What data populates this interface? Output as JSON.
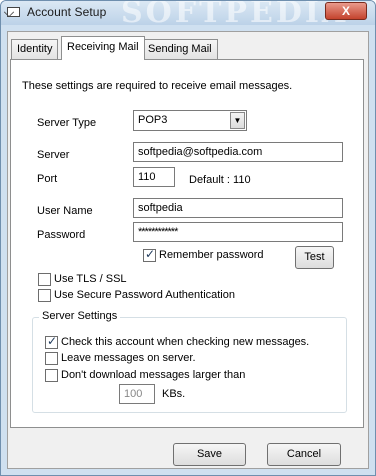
{
  "window": {
    "title": "Account Setup",
    "close_label": "X",
    "watermark": "SOFTPEDIA"
  },
  "tabs": [
    {
      "label": "Identity",
      "active": false
    },
    {
      "label": "Receiving Mail",
      "active": true
    },
    {
      "label": "Sending Mail",
      "active": false
    }
  ],
  "intro": "These settings are required to receive email messages.",
  "fields": {
    "server_type": {
      "label": "Server Type",
      "value": "POP3"
    },
    "server": {
      "label": "Server",
      "value": "softpedia@softpedia.com"
    },
    "port": {
      "label": "Port",
      "value": "110",
      "default_text": "Default : 110"
    },
    "user_name": {
      "label": "User Name",
      "value": "softpedia"
    },
    "password": {
      "label": "Password",
      "value": "************"
    }
  },
  "checkboxes": {
    "remember_password": {
      "label": "Remember password",
      "checked": true
    },
    "use_tls": {
      "label": "Use TLS / SSL",
      "checked": false
    },
    "use_spa": {
      "label": "Use Secure Password Authentication",
      "checked": false
    }
  },
  "buttons": {
    "test": "Test",
    "save": "Save",
    "cancel": "Cancel"
  },
  "server_settings": {
    "title": "Server Settings",
    "check_account": {
      "label": "Check this account when checking new messages.",
      "checked": true
    },
    "leave_messages": {
      "label": "Leave messages on server.",
      "checked": false
    },
    "dont_download": {
      "label": "Don't download messages larger than",
      "checked": false
    },
    "size_limit": {
      "value": "100",
      "unit": "KBs."
    }
  }
}
